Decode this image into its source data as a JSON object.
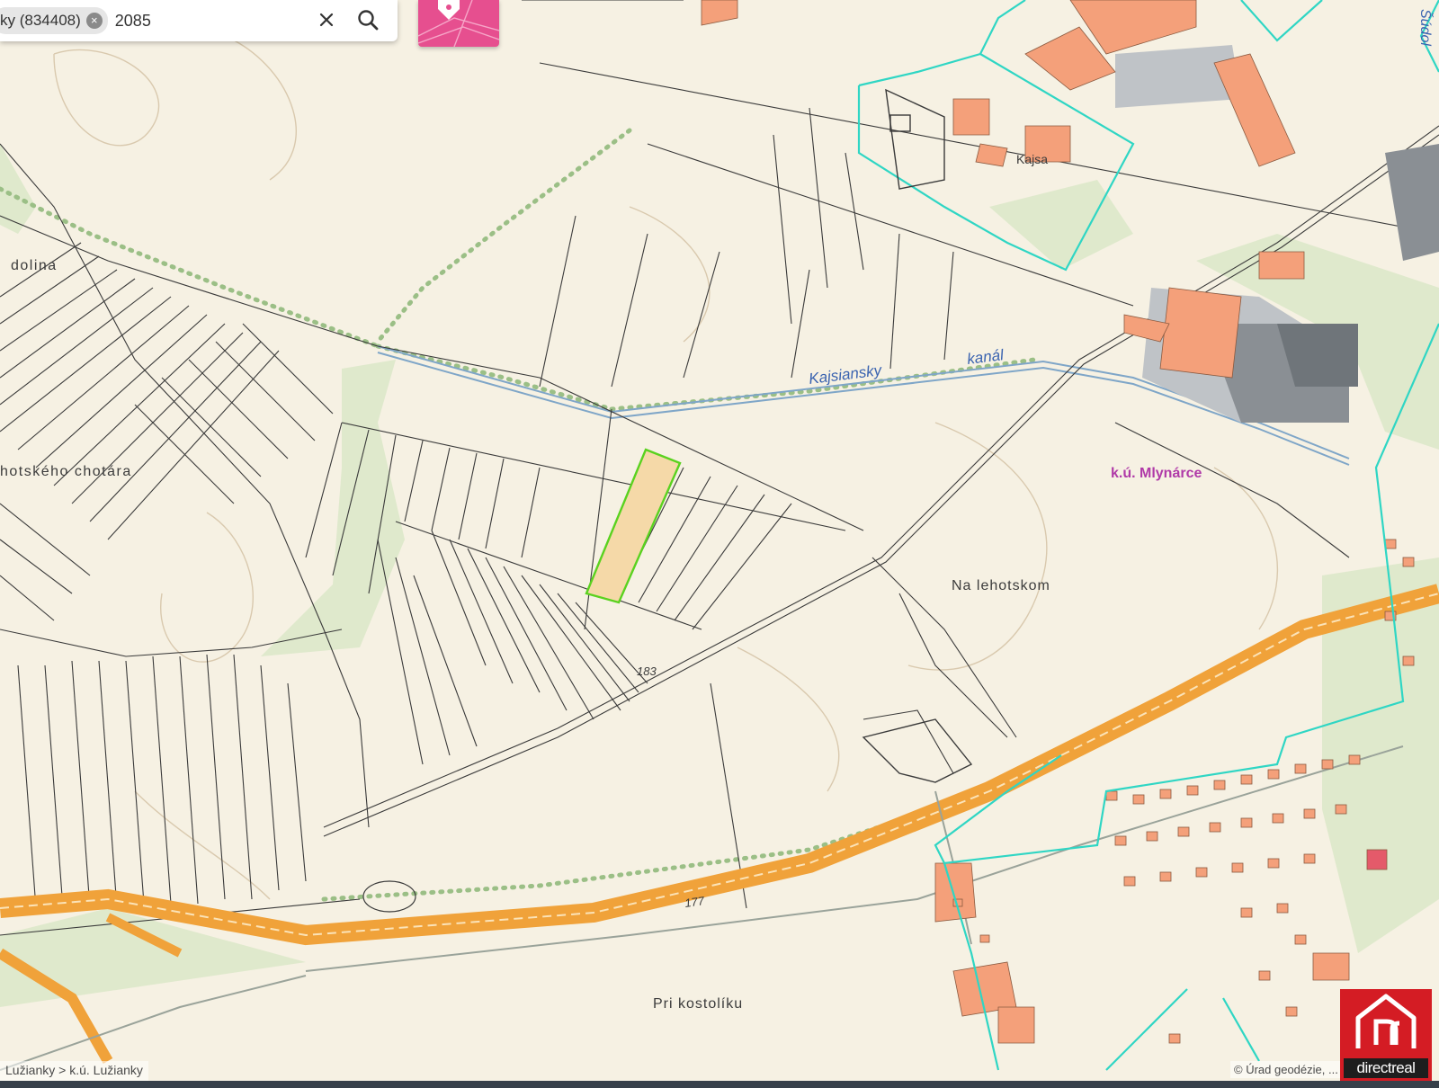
{
  "search": {
    "chip_label": "ky (834408)",
    "query": "2085",
    "clear_icon": "close-icon",
    "search_icon": "search-icon"
  },
  "layer_button": {
    "icon": "map-pin-icon",
    "color": "#e64f8f"
  },
  "map": {
    "labels": {
      "dolina": "dolina",
      "chotara": "hotského chotára",
      "kanal_1": "Kajsiansky",
      "kanal_2": "kanál",
      "mlynarce": "k.ú. Mlynárce",
      "na_lehotskom": "Na lehotskom",
      "pri_kostolku": "Pri kostolíku",
      "kajsa": "Kajsa",
      "sudol": "Šúdol",
      "elev_183": "183",
      "elev_177": "177"
    },
    "colors": {
      "background": "#f6f1e3",
      "parcel_lines": "#3a3a3a",
      "highlight_parcel": "#5ad21f",
      "highlight_fill": "#f5d9a8",
      "boundary_cadastre": "#2fd6c4",
      "road": "#f0a23a",
      "buildings": "#f4a07a",
      "industrial": "#8a8f94",
      "greenery": "#dbe8c8",
      "water": "#7fa6c8",
      "label_blue": "#3a63b0",
      "label_purple": "#b03aa8"
    }
  },
  "footer": {
    "breadcrumb": "Lužianky > k.ú. Lužianky",
    "attribution": "© Úrad geodézie, ..."
  },
  "brand": {
    "name": "directreal",
    "bg_color": "#d41c24"
  }
}
